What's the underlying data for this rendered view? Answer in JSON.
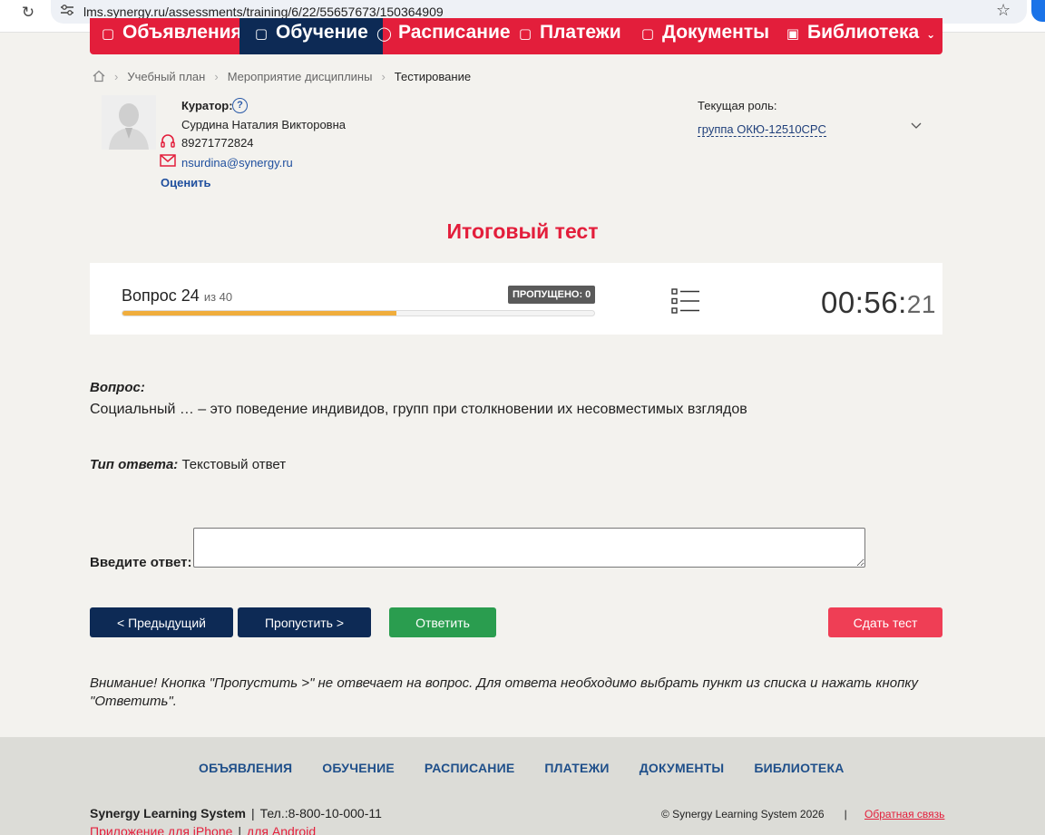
{
  "browser": {
    "url": "lms.synergy.ru/assessments/training/6/22/55657673/150364909"
  },
  "topnav": {
    "items": [
      {
        "label": "Объявления"
      },
      {
        "label": "Обучение"
      },
      {
        "label": "Расписание"
      },
      {
        "label": "Платежи"
      },
      {
        "label": "Документы"
      },
      {
        "label": "Библиотека"
      }
    ]
  },
  "breadcrumb": {
    "items": [
      "Учебный план",
      "Мероприятие дисциплины",
      "Тестирование"
    ]
  },
  "curator": {
    "title": "Куратор:",
    "help": "?",
    "name": "Сурдина Наталия Викторовна",
    "phone": "89271772824",
    "email": "nsurdina@synergy.ru",
    "rate": "Оценить"
  },
  "role": {
    "label": "Текущая роль:",
    "value": "группа ОКЮ-12510СРС"
  },
  "test": {
    "title": "Итоговый тест",
    "question_label": "Вопрос 24",
    "question_of": "из 40",
    "skipped": "ПРОПУЩЕНО: 0",
    "progress_fraction": 0.58,
    "timer_main": "00:56:",
    "timer_sec": "21"
  },
  "question": {
    "heading": "Вопрос:",
    "text": "Социальный … – это поведение индивидов, групп при столкновении их несовместимых взглядов",
    "type_label": "Тип ответа:",
    "type_value": "Текстовый ответ",
    "answer_label": "Введите ответ:",
    "answer_value": ""
  },
  "buttons": {
    "prev": "< Предыдущий",
    "skip": "Пропустить >",
    "answer": "Ответить",
    "finish": "Сдать тест"
  },
  "warning": "Внимание! Кнопка \"Пропустить >\" не отвечает на вопрос. Для ответа необходимо выбрать пункт из списка и нажать кнопку \"Ответить\".",
  "footer": {
    "nav": [
      "ОБЪЯВЛЕНИЯ",
      "ОБУЧЕНИЕ",
      "РАСПИСАНИЕ",
      "ПЛАТЕЖИ",
      "ДОКУМЕНТЫ",
      "БИБЛИОТЕКА"
    ],
    "brand": "Synergy Learning System",
    "phone": "Тел.:8-800-10-000-11",
    "app_iphone": "Приложение для iPhone",
    "app_android": "для Android",
    "copyright": "© Synergy Learning System 2026",
    "feedback": "Обратная связь"
  },
  "colors": {
    "accent_red": "#e31e3b",
    "navy": "#0d2a55",
    "green": "#2a9d4f",
    "progress": "#f0ad3c"
  }
}
